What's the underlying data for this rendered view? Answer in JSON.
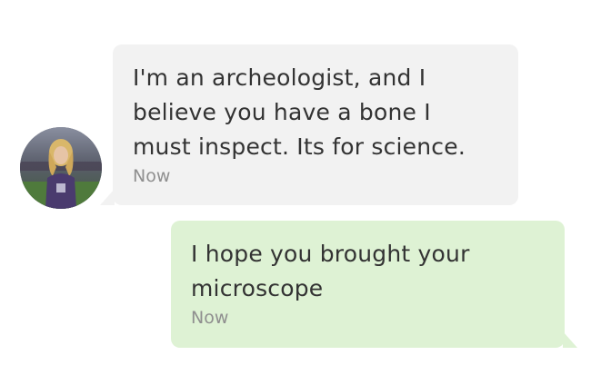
{
  "messages": {
    "incoming": {
      "text": "I'm an archeologist, and I\nbelieve you have a bone I\nmust inspect. Its for science.",
      "time": "Now",
      "bubble_color": "#f2f2f2",
      "avatar": "profile-photo"
    },
    "outgoing": {
      "text": "I hope you brought your\nmicroscope",
      "time": "Now",
      "bubble_color": "#def2d4"
    }
  }
}
